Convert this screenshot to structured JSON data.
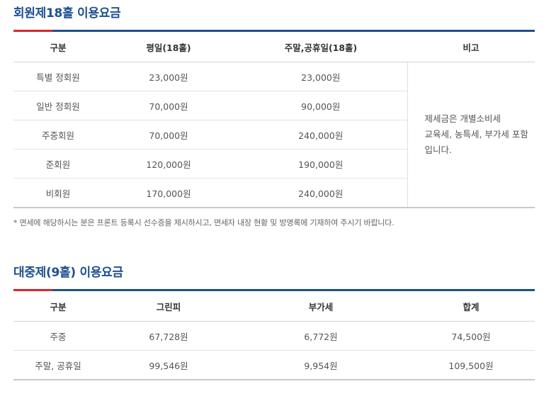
{
  "membership_fees": {
    "title": "회원제18홀 이용요금",
    "headers": [
      "구분",
      "평일(18홀)",
      "주말,공휴일(18홀)",
      "비고"
    ],
    "rows": [
      {
        "category": "특별 정회원",
        "weekday": "23,000원",
        "weekend": "23,000원"
      },
      {
        "category": "일반 정회원",
        "weekday": "70,000원",
        "weekend": "90,000원"
      },
      {
        "category": "주중회원",
        "weekday": "70,000원",
        "weekend": "240,000원"
      },
      {
        "category": "준회원",
        "weekday": "120,000원",
        "weekend": "190,000원"
      },
      {
        "category": "비회원",
        "weekday": "170,000원",
        "weekend": "240,000원"
      }
    ],
    "note_lines": [
      "제세금은 개별소비세",
      "교육세, 농특세, 부가세 포함",
      "입니다."
    ],
    "footnote": "* 면세에 해당하시는 분은 프론트 등록시 선수증을 제시하시고, 면세자 내장 현황 및 방명록에 기재하여 주시기 바랍니다."
  },
  "public_fees": {
    "title": "대중제(9홀) 이용요금",
    "headers": [
      "구분",
      "그린피",
      "부가세",
      "합계"
    ],
    "rows": [
      {
        "category": "주중",
        "green_fee": "67,728원",
        "vat": "6,772원",
        "total": "74,500원"
      },
      {
        "category": "주말, 공휴일",
        "green_fee": "99,546원",
        "vat": "9,954원",
        "total": "109,500원"
      }
    ]
  },
  "colors": {
    "title": "#1d4f91",
    "accent": "#d9262b"
  }
}
